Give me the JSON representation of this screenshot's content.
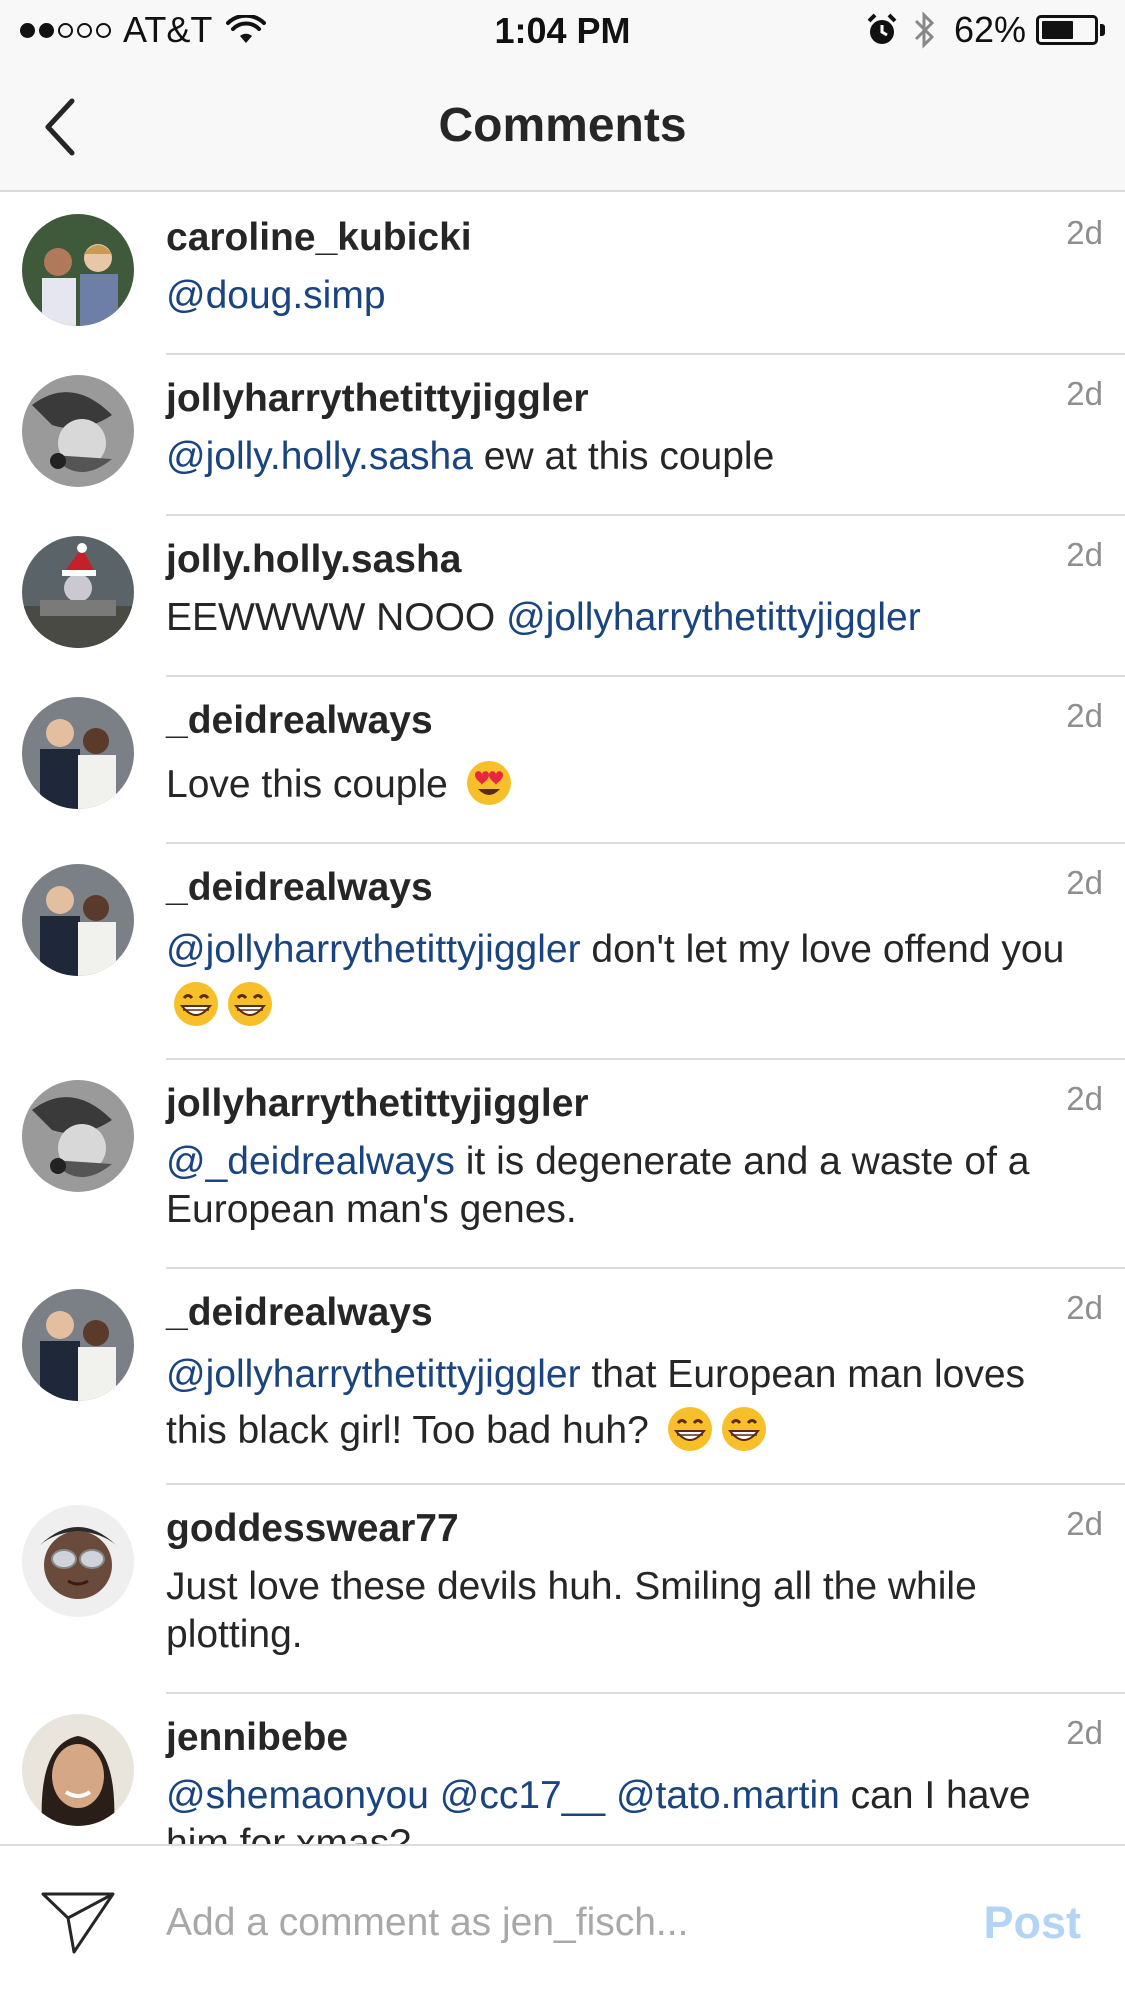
{
  "status_bar": {
    "carrier": "AT&T",
    "signal_bars_filled": 2,
    "signal_bars_total": 5,
    "time": "1:04 PM",
    "battery_percent_label": "62%",
    "battery_level": 0.62,
    "icons": [
      "signal-dots-icon",
      "wifi-icon",
      "alarm-icon",
      "bluetooth-icon",
      "battery-icon"
    ]
  },
  "nav": {
    "title": "Comments",
    "back_icon": "chevron-left-icon"
  },
  "comments": [
    {
      "username": "caroline_kubicki",
      "time": "2d",
      "parts": [
        {
          "mention": "@doug.simp"
        }
      ]
    },
    {
      "username": "jollyharrythetittyjiggler",
      "time": "2d",
      "parts": [
        {
          "mention": "@jolly.holly.sasha"
        },
        {
          "text": " ew at this couple"
        }
      ]
    },
    {
      "username": "jolly.holly.sasha",
      "time": "2d",
      "parts": [
        {
          "text": "EEWWWW NOOO "
        },
        {
          "mention": "@jollyharrythetittyjiggler"
        }
      ]
    },
    {
      "username": "_deidrealways",
      "time": "2d",
      "parts": [
        {
          "text": "Love this couple "
        },
        {
          "emoji": "heart-eyes"
        }
      ]
    },
    {
      "username": "_deidrealways",
      "time": "2d",
      "parts": [
        {
          "mention": "@jollyharrythetittyjiggler"
        },
        {
          "text": " don't let my love offend you "
        },
        {
          "emoji": "grin"
        },
        {
          "emoji": "grin"
        }
      ]
    },
    {
      "username": "jollyharrythetittyjiggler",
      "time": "2d",
      "parts": [
        {
          "mention": "@_deidrealways"
        },
        {
          "text": " it is degenerate and a waste of a European man's genes."
        }
      ]
    },
    {
      "username": "_deidrealways",
      "time": "2d",
      "parts": [
        {
          "mention": "@jollyharrythetittyjiggler"
        },
        {
          "text": " that European man loves this black girl! Too bad huh? "
        },
        {
          "emoji": "grin"
        },
        {
          "emoji": "grin"
        }
      ]
    },
    {
      "username": "goddesswear77",
      "time": "2d",
      "parts": [
        {
          "text": "Just love these devils huh. Smiling all the while plotting."
        }
      ]
    },
    {
      "username": "jennibebe",
      "time": "2d",
      "parts": [
        {
          "mention": "@shemaonyou"
        },
        {
          "text": " "
        },
        {
          "mention": "@cc17__"
        },
        {
          "text": " "
        },
        {
          "mention": "@tato.martin"
        },
        {
          "text": " can I have him for xmas?"
        }
      ]
    }
  ],
  "composer": {
    "placeholder": "Add a comment as jen_fisch...",
    "post_label": "Post",
    "send_icon": "paper-plane-icon"
  },
  "colors": {
    "mention": "#1a4480",
    "username": "#262626",
    "timestamp": "#8e8e8e",
    "post_disabled": "#b3d4f5",
    "divider": "#dbdbdb",
    "bar_background": "#f8f8f8"
  }
}
